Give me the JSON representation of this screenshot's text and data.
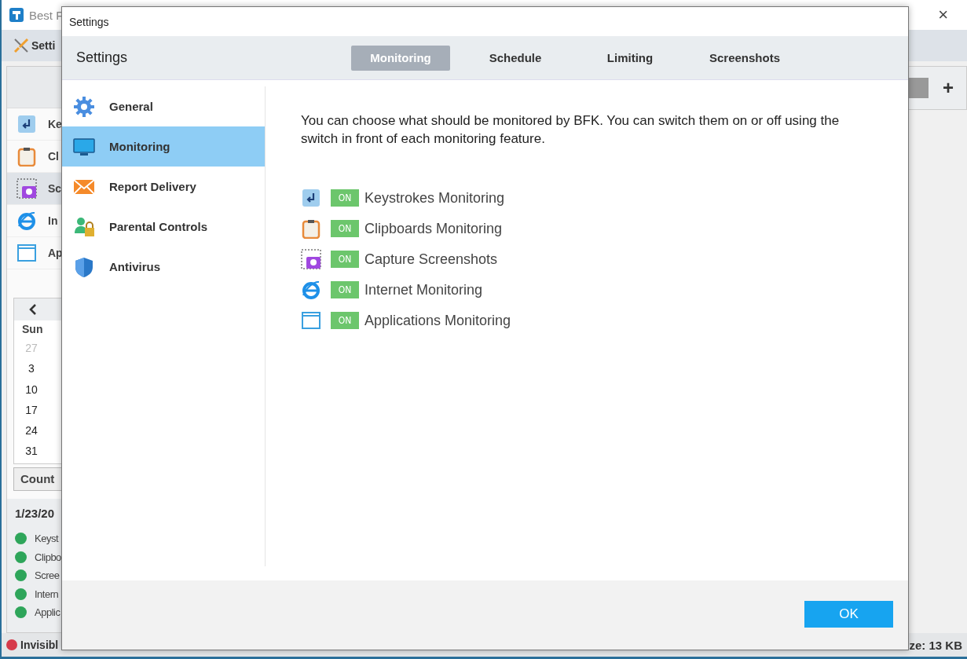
{
  "background_window": {
    "title": "Best F",
    "close": "×",
    "toolbar_item": "Setti",
    "add": "+",
    "features": [
      {
        "label": "Ke",
        "selected": false
      },
      {
        "label": "Cl",
        "selected": false
      },
      {
        "label": "Sc",
        "selected": true
      },
      {
        "label": "In",
        "selected": false
      },
      {
        "label": "Ap",
        "selected": false
      }
    ],
    "calendar": {
      "weekday": "Sun",
      "days": [
        {
          "text": "27",
          "other_month": true
        },
        {
          "text": "3",
          "other_month": false
        },
        {
          "text": "10",
          "other_month": false
        },
        {
          "text": "17",
          "other_month": false
        },
        {
          "text": "24",
          "other_month": false
        },
        {
          "text": "31",
          "other_month": false
        }
      ]
    },
    "count_button": "Count",
    "date": "1/23/20",
    "legend": [
      "Keyst",
      "Clipbo",
      "Scree",
      "Intern",
      "Applic"
    ],
    "status": {
      "mode": "Invisibl",
      "size": "ze: 13 KB"
    }
  },
  "dialog": {
    "title": "Settings",
    "header": "Settings",
    "tabs": [
      {
        "label": "Monitoring",
        "selected": true
      },
      {
        "label": "Schedule",
        "selected": false
      },
      {
        "label": "Limiting",
        "selected": false
      },
      {
        "label": "Screenshots",
        "selected": false
      }
    ],
    "sidebar": [
      {
        "label": "General",
        "selected": false
      },
      {
        "label": "Monitoring",
        "selected": true
      },
      {
        "label": "Report Delivery",
        "selected": false
      },
      {
        "label": "Parental Controls",
        "selected": false
      },
      {
        "label": "Antivirus",
        "selected": false
      }
    ],
    "intro": "You can choose what should be monitored by BFK. You can switch them on or off using the switch in front of each monitoring feature.",
    "features": [
      {
        "label": "Keystrokes Monitoring",
        "on": true,
        "switch": "ON"
      },
      {
        "label": "Clipboards Monitoring",
        "on": true,
        "switch": "ON"
      },
      {
        "label": "Capture Screenshots",
        "on": true,
        "switch": "ON"
      },
      {
        "label": "Internet Monitoring",
        "on": true,
        "switch": "ON"
      },
      {
        "label": "Applications Monitoring",
        "on": true,
        "switch": "ON"
      }
    ],
    "ok": "OK"
  }
}
